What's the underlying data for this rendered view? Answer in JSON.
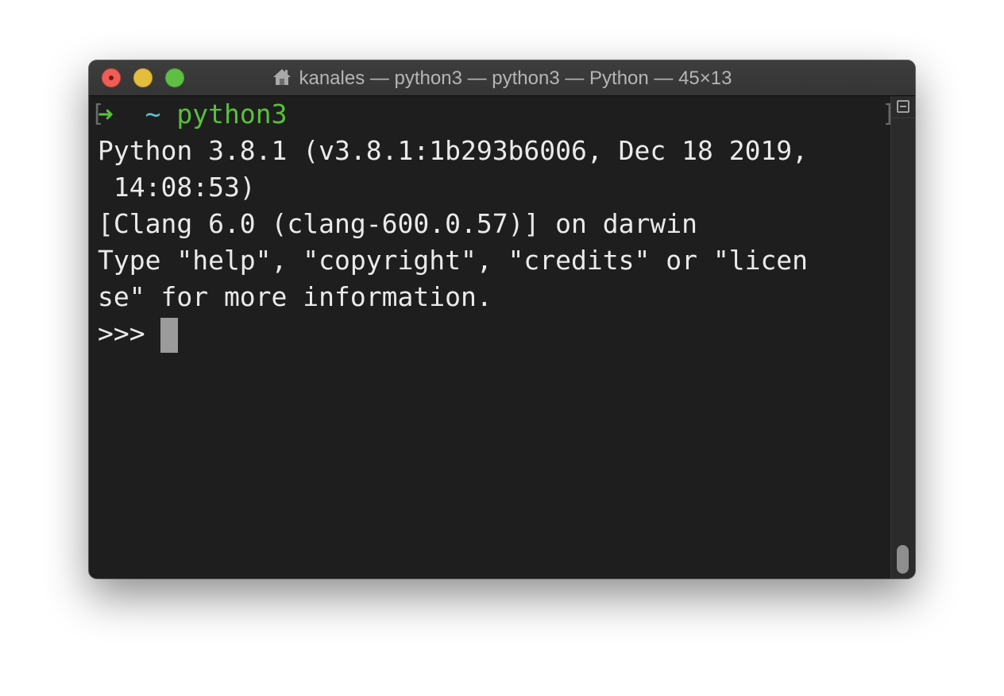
{
  "window": {
    "title": "kanales — python3 — python3 — Python — 45×13",
    "title_icon": "home-icon"
  },
  "colors": {
    "prompt_arrow": "#58c13a",
    "prompt_tilde": "#5bc5d6",
    "prompt_command": "#58c13a",
    "text": "#eaeaea",
    "background": "#1e1e1e"
  },
  "terminal": {
    "prompt": {
      "arrow": "➜",
      "dir": "~",
      "command": "python3"
    },
    "output_lines": [
      "Python 3.8.1 (v3.8.1:1b293b6006, Dec 18 2019,",
      " 14:08:53)",
      "[Clang 6.0 (clang-600.0.57)] on darwin",
      "Type \"help\", \"copyright\", \"credits\" or \"licen",
      "se\" for more information."
    ],
    "repl_prompt": ">>> "
  }
}
